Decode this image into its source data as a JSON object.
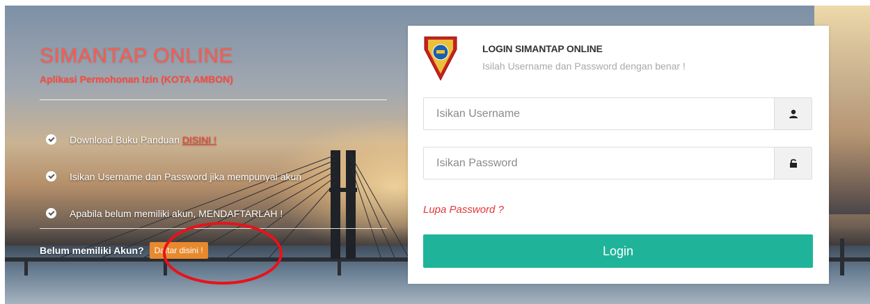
{
  "brand": {
    "title": "SIMANTAP ONLINE",
    "subtitle": "Aplikasi Permohonan Izin (KOTA AMBON)"
  },
  "info": {
    "items": [
      {
        "text": "Download Buku Panduan",
        "link": "DISINI !"
      },
      {
        "text": "Isikan Username dan Password jika mempunyai akun"
      },
      {
        "text": "Apabila belum memiliki akun, MENDAFTARLAH !"
      }
    ]
  },
  "signup": {
    "question": "Belum memiliki Akun?",
    "button_label": "Daftar disini !"
  },
  "login": {
    "title": "LOGIN SIMANTAP ONLINE",
    "subtitle": "Isilah Username dan Password dengan benar !",
    "username_placeholder": "Isikan Username",
    "password_placeholder": "Isikan Password",
    "forgot_label": "Lupa Password ?",
    "button_label": "Login"
  },
  "icons": {
    "check": "check-circle-icon",
    "user": "user-icon",
    "lock": "unlock-icon",
    "logo": "kota-ambon-shield-logo"
  },
  "colors": {
    "brand_red": "#ff5a4e",
    "signup_orange": "#e8892d",
    "login_teal": "#1fb49a",
    "forgot_red": "#e3363a",
    "annotation_red": "#e8121a"
  }
}
